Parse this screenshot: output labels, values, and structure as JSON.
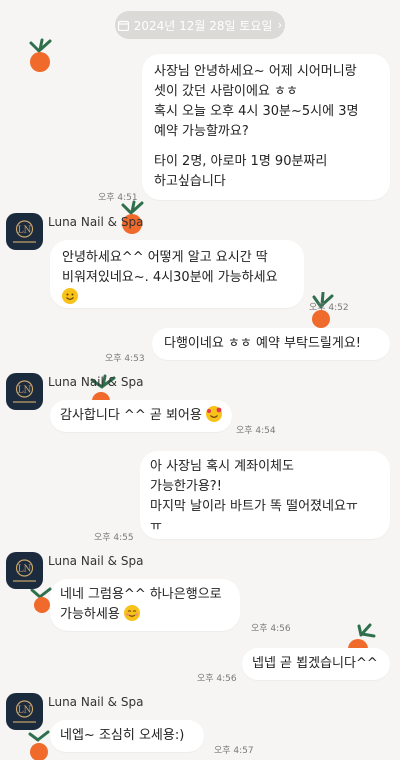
{
  "date_divider": "2024년 12월 28일 토요일",
  "sender_name": "Luna Nail & Spa",
  "messages": [
    {
      "side": "out",
      "lines": [
        "사장님 안녕하세요~ 어제 시어머니랑",
        "셋이 갔던 사람이에요 ㅎㅎ",
        "혹시 오늘 오후 4시 30분~5시에 3명",
        "예약 가능할까요?",
        "",
        "타이 2명, 아로마 1명 90분짜리",
        "하고싶습니다"
      ],
      "time": "오후 4:51"
    },
    {
      "side": "in",
      "lines": [
        "안녕하세요^^ 어떻게 알고 요시간 딱",
        "비워져있네요~. 4시30분에 가능하세요"
      ],
      "time": "오후 4:52"
    },
    {
      "side": "out",
      "lines": [
        "다행이네요 ㅎㅎ 예약 부탁드릴게요!"
      ],
      "time": "오후 4:53"
    },
    {
      "side": "in",
      "lines": [
        "감사합니다 ^^ 곧 뵈어용"
      ],
      "time": "오후 4:54"
    },
    {
      "side": "out",
      "lines": [
        "아 사장님 혹시 계좌이체도",
        "가능한가용?!",
        "마지막 날이라 바트가 똑 떨어졌네요ㅠ",
        "ㅠ"
      ],
      "time": "오후 4:55"
    },
    {
      "side": "in",
      "lines": [
        "네네 그럼용^^ 하나은행으로",
        "가능하세용"
      ],
      "time": "오후 4:56"
    },
    {
      "side": "out",
      "lines": [
        "넵넵 곧 뵙겠습니다^^"
      ],
      "time": "오후 4:56"
    },
    {
      "side": "in",
      "lines": [
        "네엡~ 조심히 오세용:)"
      ],
      "time": "오후 4:57"
    }
  ],
  "icons": {
    "date": "calendar-icon",
    "chevron": "chevron-right-icon",
    "decor": "tangerine-sticker-icon"
  },
  "colors": {
    "bubble": "#ffffff",
    "background": "#f6f5f3",
    "pill": "#dcdad7",
    "avatar": "#1c2a3e",
    "tangerine": "#ef6a2b",
    "leaf": "#2f6f4e"
  }
}
